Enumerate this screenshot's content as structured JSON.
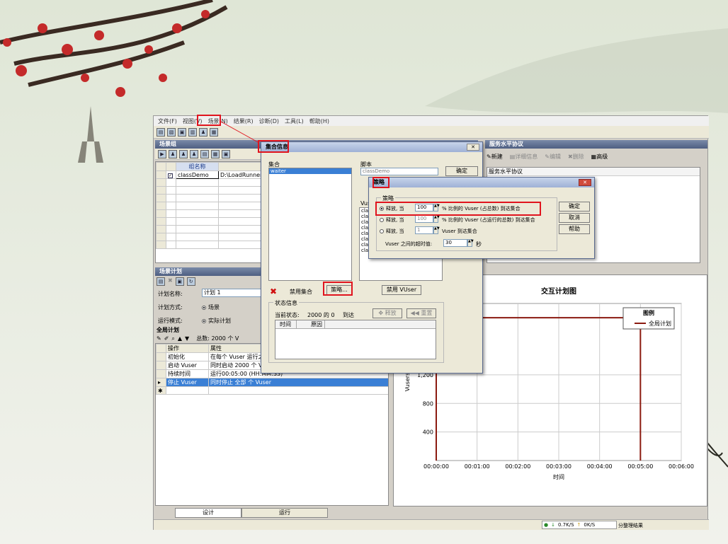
{
  "colors": {
    "accent_red": "#e0141e",
    "title_blue": "#4e5f82",
    "selection": "#3a7fd5",
    "plot_line": "#8b1a10"
  },
  "menu": [
    "文件(F)",
    "视图(V)",
    "场景(N)",
    "结果(R)",
    "诊断(D)",
    "工具(L)",
    "帮助(H)"
  ],
  "toolbar_icons": [
    "new-icon",
    "open-icon",
    "save-icon",
    "bar-chart-icon",
    "vuser-icon",
    "run-icon"
  ],
  "scenario_groups": {
    "title": "场景组",
    "header": "组名称",
    "rows": [
      {
        "name": "classDemo",
        "path": "D:\\LoadRunnerTest"
      }
    ]
  },
  "sla": {
    "title": "服务水平协议",
    "new": "新建",
    "details": "详细信息",
    "edit": "编辑",
    "delete": "删除",
    "advanced": "高级",
    "column": "服务水平协议"
  },
  "schedule": {
    "title": "场景计划",
    "plan_name_label": "计划名称:",
    "plan_name": "计划 1",
    "plan_mode_label": "计划方式:",
    "plan_mode": "场景",
    "run_mode_label": "运行模式:",
    "run_mode": "实际计划",
    "global_title": "全局计划",
    "total": "总数: 2000 个 V",
    "col_action": "操作",
    "col_attr": "属性",
    "rows": [
      {
        "action": "初始化",
        "attr": "在每个 Vuser 运行之"
      },
      {
        "action": "启动 Vuser",
        "attr": "同时启动 2000 个 Vu"
      },
      {
        "action": "持续时间",
        "attr": "运行00:05:00 (HH:MM:SS)"
      },
      {
        "action": "停止 Vuser",
        "attr": "同时停止 全部 个 Vuser"
      }
    ]
  },
  "rendezvous": {
    "title": "集合信息",
    "rendezvous_label": "集合",
    "rendezvous_item": "waiter",
    "script_label": "脚本",
    "script_value": "classDemo",
    "ok": "确定",
    "vuser_label": "Vuser",
    "vusers": [
      "classDemo:1000",
      "classDemo:1001",
      "classDemo:1002",
      "classDemo:1003",
      "classDemo:1004",
      "classDemo:1005",
      "classDemo:1006",
      "classDemo:1007"
    ],
    "disable_rendezvous": "禁用集合",
    "policy": "策略...",
    "disable_vuser": "禁用 VUser",
    "status_title": "状态信息",
    "current_status_label": "当前状态:",
    "current_status_value": "2000 的 0",
    "arrived": "到达",
    "release": "释放",
    "reset": "重置",
    "col_time": "时间",
    "col_reason": "原因"
  },
  "policy": {
    "title": "策略",
    "group": "策略",
    "opt1_a": "释放, 当",
    "opt1_value": "100",
    "opt1_b": "% 比例的 Vuser (占总数) 到达集合",
    "opt2_a": "释放, 当",
    "opt2_value": "100",
    "opt2_b": "% 比例的 Vuser (占运行的总数) 到达集合",
    "opt3_a": "释放, 当",
    "opt3_value": "1",
    "opt3_b": "Vuser 到达集合",
    "timeout_label": "Vuser 之间的超时值:",
    "timeout_value": "30",
    "timeout_unit": "秒",
    "ok": "确定",
    "cancel": "取消",
    "help": "帮助"
  },
  "chart_data": {
    "type": "line",
    "title": "交互计划图",
    "xlabel": "时间",
    "ylabel": "Vusers",
    "x_ticks": [
      "00:00:00",
      "00:01:00",
      "00:02:00",
      "00:03:00",
      "00:04:00",
      "00:05:00",
      "00:06:00"
    ],
    "y_ticks": [
      400,
      800,
      1200
    ],
    "xlim_minutes": [
      0,
      6
    ],
    "ylim": [
      0,
      2200
    ],
    "legend_title": "图例",
    "legend_placement": "top-right",
    "series": [
      {
        "name": "全局计划",
        "points": [
          [
            0,
            0
          ],
          [
            0,
            2000
          ],
          [
            5,
            2000
          ],
          [
            5,
            0
          ]
        ]
      }
    ]
  },
  "bottom_tabs": {
    "design": "设计",
    "run": "运行"
  },
  "statusbar": {
    "upload": "0.7K/S",
    "download": "0K/S",
    "text": "分整理结果"
  }
}
